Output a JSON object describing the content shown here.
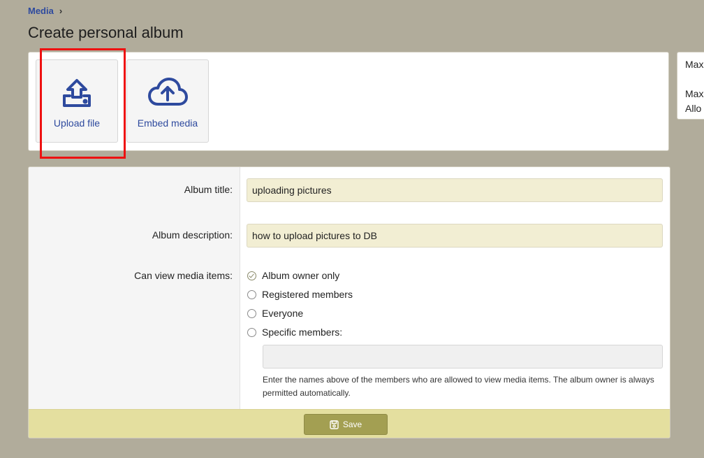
{
  "breadcrumb": {
    "item": "Media",
    "separator": "›"
  },
  "page": {
    "title": "Create personal album"
  },
  "upload": {
    "upload_label": "Upload file",
    "embed_label": "Embed media"
  },
  "side_info": {
    "line1": "Max",
    "line2": "Max",
    "line3": "Allo"
  },
  "form": {
    "album_title_label": "Album title:",
    "album_title_value": "uploading pictures",
    "album_description_label": "Album description:",
    "album_description_value": "how to upload pictures to DB",
    "can_view_label": "Can view media items:",
    "options": [
      {
        "label": "Album owner only",
        "checked": true
      },
      {
        "label": "Registered members",
        "checked": false
      },
      {
        "label": "Everyone",
        "checked": false
      },
      {
        "label": "Specific members:",
        "checked": false
      }
    ],
    "hint": "Enter the names above of the members who are allowed to view media items. The album owner is always permitted automatically.",
    "save_label": "Save"
  },
  "colors": {
    "accent": "#2e4a9e",
    "highlight": "#ee1111",
    "save_button": "#a39f52",
    "footer": "#e4df9f",
    "input_fill": "#f2eed3"
  }
}
